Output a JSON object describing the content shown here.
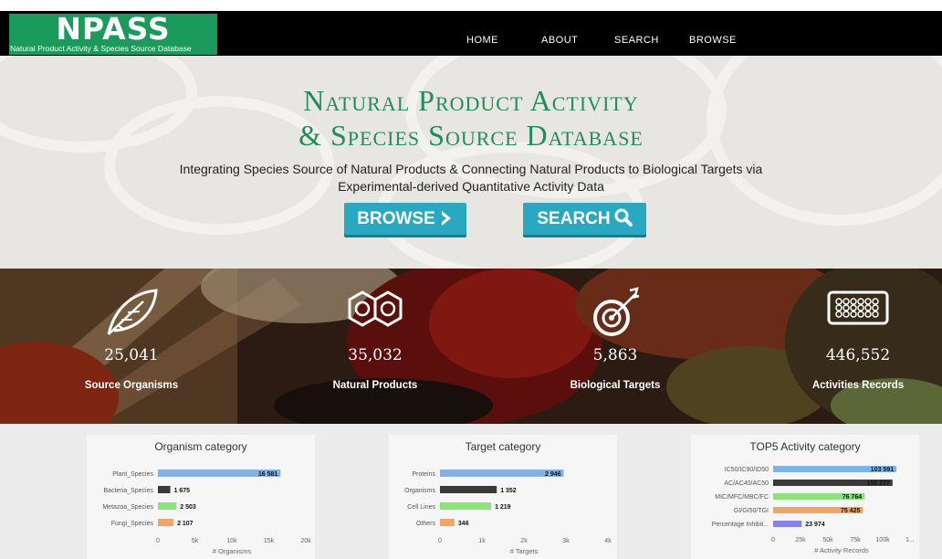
{
  "logo": {
    "title": "NPASS",
    "subtitle": "Natural Product Activity & Species Source Database"
  },
  "nav": {
    "home": "HOME",
    "about": "ABOUT",
    "search": "SEARCH",
    "browse": "BROWSE"
  },
  "hero": {
    "title_line1": "Natural Product Activity",
    "title_line2": "& Species Source Database",
    "desc_line1": "Integrating Species Source of Natural Products & Connecting Natural Products to Biological Targets via",
    "desc_line2": "Experimental-derived Quantitative Activity Data",
    "browse_button": "BROWSE",
    "search_button": "SEARCH"
  },
  "stats": [
    {
      "value": "25,041",
      "label": "Source Organisms",
      "icon": "leaf-icon"
    },
    {
      "value": "35,032",
      "label": "Natural Products",
      "icon": "molecule-icon"
    },
    {
      "value": "5,863",
      "label": "Biological Targets",
      "icon": "target-icon"
    },
    {
      "value": "446,552",
      "label": "Activities Records",
      "icon": "plate-icon"
    }
  ],
  "colors": {
    "brand_green": "#1a9a5b",
    "title_green": "#1f8f55",
    "button_blue": "#29a8c2",
    "bar_blue": "#7fb3e8",
    "bar_dark": "#3a3a3a",
    "bar_green": "#8fe07f",
    "bar_orange": "#f4a460",
    "bar_purple": "#8484e8"
  },
  "chart_data": [
    {
      "type": "bar",
      "orientation": "horizontal",
      "title": "Organism category",
      "categories": [
        "Plant_Species",
        "Bacteria_Species",
        "Metazoa_Species",
        "Fungi_Species"
      ],
      "values": [
        16581,
        1675,
        2503,
        2107
      ],
      "value_labels": [
        "16 581",
        "1 675",
        "2 503",
        "2 107"
      ],
      "bar_colors": [
        "#7fb3e8",
        "#3a3a3a",
        "#8fe07f",
        "#f4a460"
      ],
      "xlim": [
        0,
        20000
      ],
      "ticks": [
        "0",
        "5k",
        "10k",
        "15k",
        "20k"
      ],
      "xlabel": "# Organisms"
    },
    {
      "type": "bar",
      "orientation": "horizontal",
      "title": "Target category",
      "categories": [
        "Proteins",
        "Organisms",
        "Cell Lines",
        "Others"
      ],
      "values": [
        2946,
        1352,
        1219,
        346
      ],
      "value_labels": [
        "2 946",
        "1 352",
        "1 219",
        "346"
      ],
      "bar_colors": [
        "#7fb3e8",
        "#3a3a3a",
        "#8fe07f",
        "#f4a460"
      ],
      "xlim": [
        0,
        4000
      ],
      "ticks": [
        "0",
        "1k",
        "2k",
        "3k",
        "4k"
      ],
      "xlabel": "# Targets"
    },
    {
      "type": "bar",
      "orientation": "horizontal",
      "title": "TOP5 Activity category",
      "categories": [
        "IC50/IC90/ID50",
        "AC/AC40/AC50",
        "MIC/MFC/MBC/FC",
        "GI/GI50/TGI",
        "Percentage Inhibit..."
      ],
      "values": [
        103591,
        100277,
        76764,
        75425,
        23974
      ],
      "value_labels": [
        "103 591",
        "100 277",
        "76 764",
        "75 425",
        "23 974"
      ],
      "bar_colors": [
        "#7fb3e8",
        "#3a3a3a",
        "#8fe07f",
        "#f4a460",
        "#8484e8"
      ],
      "xlim": [
        0,
        115000
      ],
      "ticks": [
        "0",
        "25k",
        "50k",
        "75k",
        "100k",
        "1..."
      ],
      "xlabel": "# Activity Records"
    }
  ]
}
